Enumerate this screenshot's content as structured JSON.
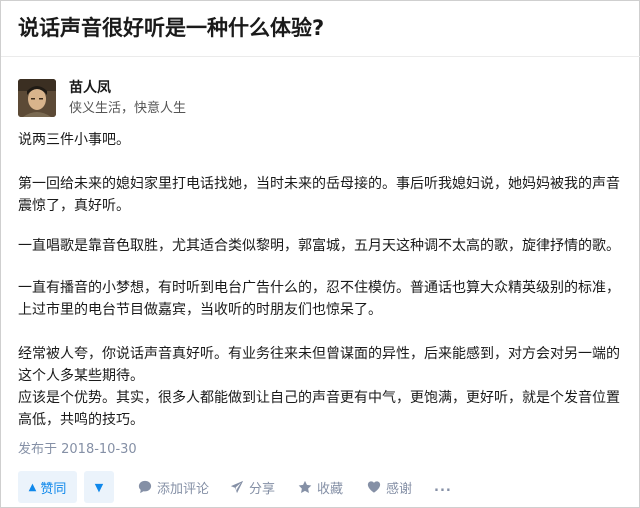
{
  "question": {
    "title": "说话声音很好听是一种什么体验?"
  },
  "author": {
    "name": "苗人凤",
    "bio": "侠义生活，快意人生"
  },
  "answer": {
    "lines": [
      "说两三件小事吧。",
      "第一回给未来的媳妇家里打电话找她，当时未来的岳母接的。事后听我媳妇说，她妈妈被我的声音",
      "震惊了，真好听。",
      "一直唱歌是靠音色取胜，尤其适合类似黎明，郭富城，五月天这种调不太高的歌，旋律抒情的歌。",
      "一直有播音的小梦想，有时听到电台广告什么的，忍不住模仿。普通话也算大众精英级别的标准，",
      "上过市里的电台节目做嘉宾，当收听的时朋友们也惊呆了。",
      "经常被人夸，你说话声音真好听。有业务往来未但曾谋面的异性，后来能感到，对方会对另一端的",
      "这个人多某些期待。",
      "应该是个优势。其实，很多人都能做到让自己的声音更有中气，更饱满，更好听，就是个发音位置",
      "高低，共鸣的技巧。"
    ],
    "date": "发布于 2018-10-30"
  },
  "actions": {
    "vote_up": "赞同",
    "comment": "添加评论",
    "share": "分享",
    "favorite": "收藏",
    "thanks": "感谢",
    "more": "..."
  }
}
